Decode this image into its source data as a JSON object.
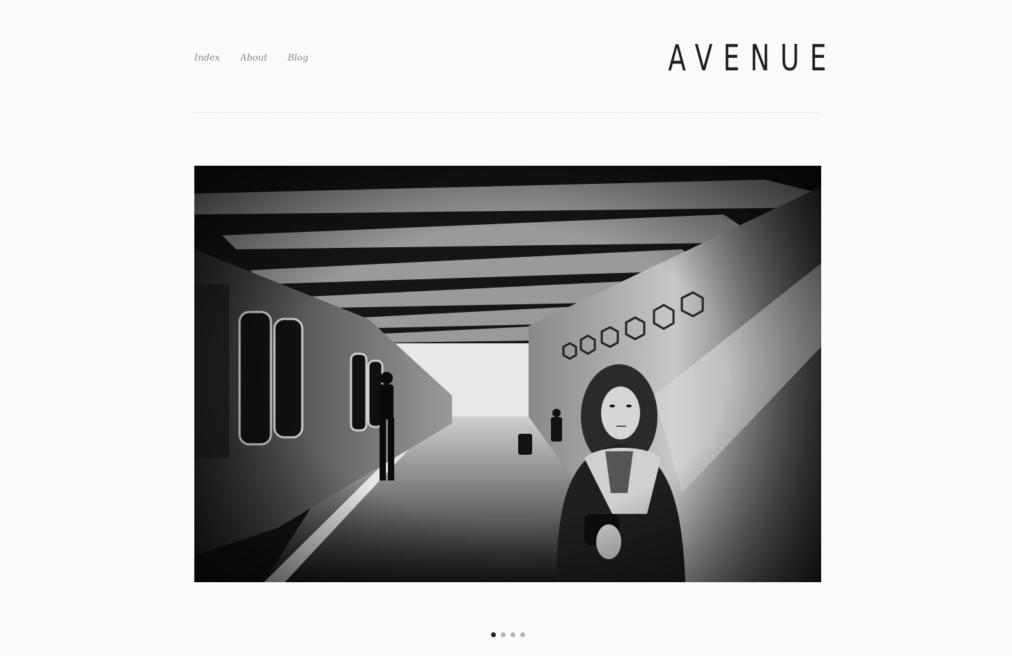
{
  "nav": {
    "items": [
      {
        "label": "Index"
      },
      {
        "label": "About"
      },
      {
        "label": "Blog"
      }
    ]
  },
  "site": {
    "logo": "AVENUE"
  },
  "slideshow": {
    "slide_count": 4,
    "active_index": 0
  }
}
